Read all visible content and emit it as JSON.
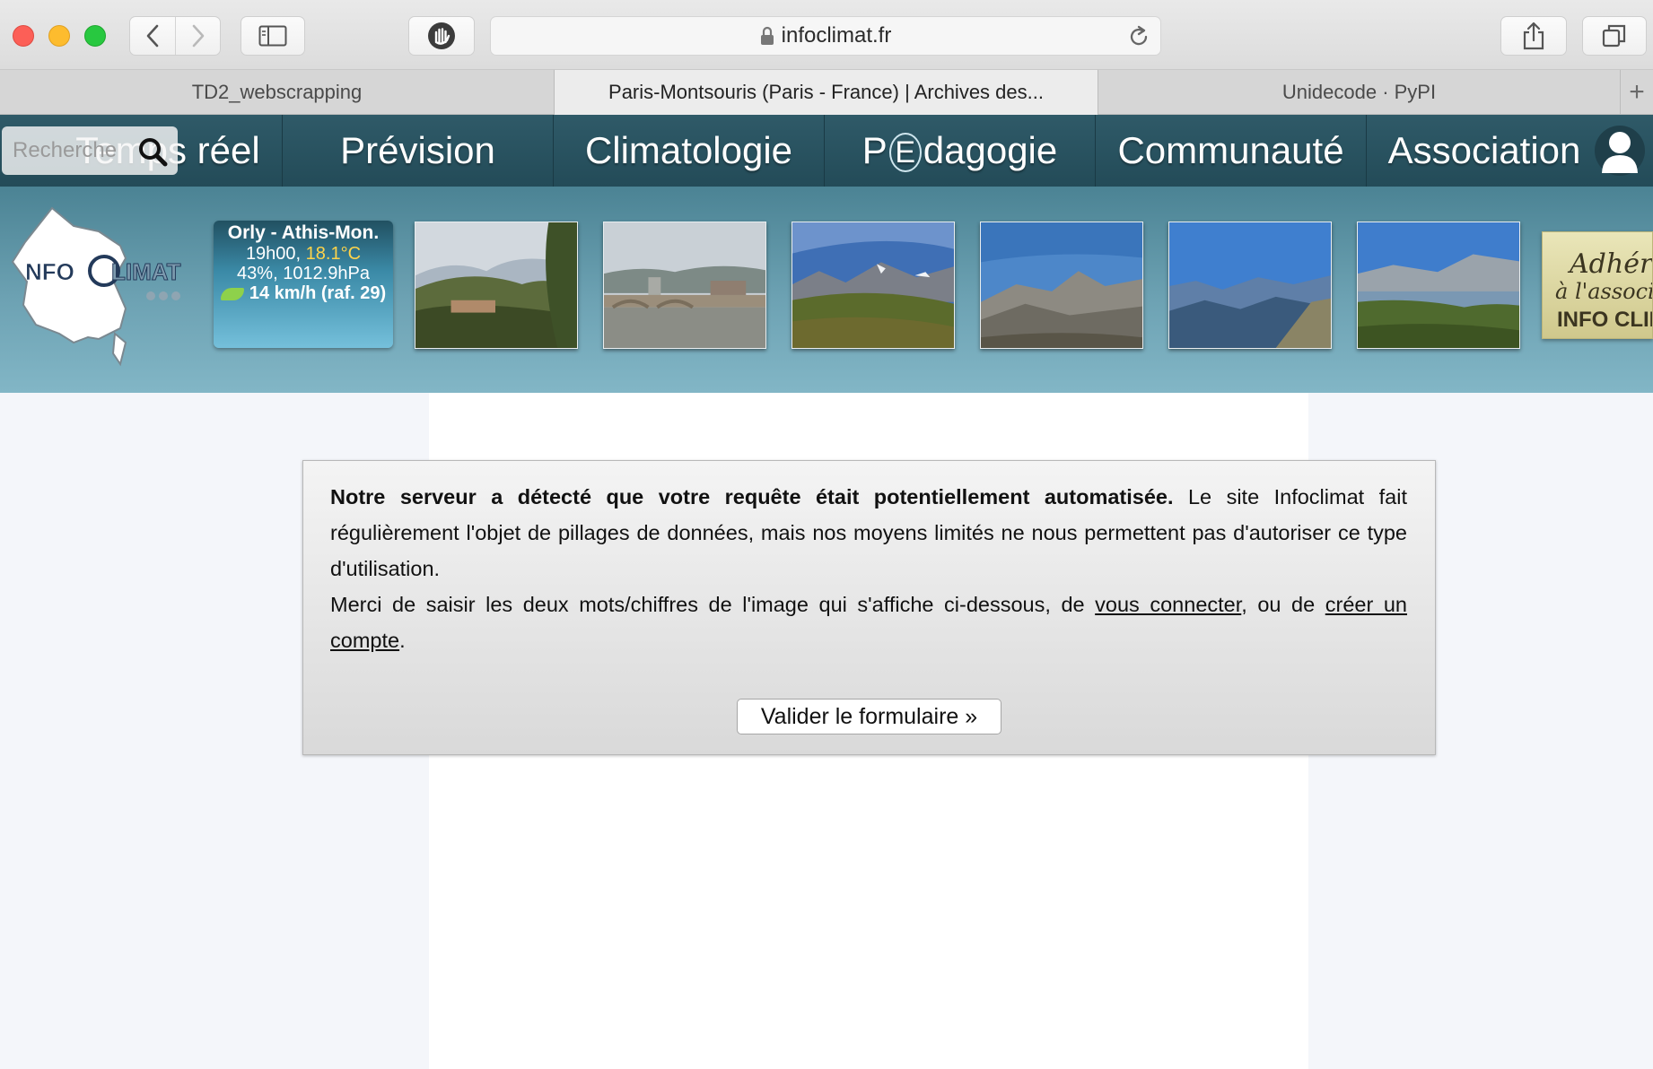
{
  "browser": {
    "url": "infoclimat.fr",
    "tabs": [
      {
        "label": "TD2_webscrapping",
        "active": false
      },
      {
        "label": "Paris-Montsouris (Paris - France) | Archives des...",
        "active": true
      },
      {
        "label": "Unidecode · PyPI",
        "active": false
      }
    ],
    "new_tab_symbol": "+",
    "icons": {
      "back": "chevron-left-icon",
      "forward": "chevron-right-icon",
      "sidebar": "sidebar-icon",
      "privacy": "hand-icon",
      "lock": "lock-icon",
      "reload": "reload-icon",
      "share": "share-icon",
      "tabs": "tabs-overview-icon"
    }
  },
  "site_nav": {
    "search_placeholder": "Recherche",
    "items": [
      {
        "label": "Temps réel"
      },
      {
        "label": "Prévision"
      },
      {
        "label": "Climatologie"
      },
      {
        "label_prefix": "P",
        "label_badge": "E",
        "label_suffix": "dagogie"
      },
      {
        "label": "Communauté"
      },
      {
        "label": "Association"
      }
    ],
    "colors": {
      "nav_bg": "#2a5362",
      "banner_bg": "#6da2b3"
    }
  },
  "banner": {
    "logo_text_left": "NFO",
    "logo_text_right": "LIMAT",
    "weather": {
      "station": "Orly - Athis-Mon.",
      "time": "19h00, ",
      "temperature": "18.1°C",
      "humidity_pressure": "43%, 1012.9hPa",
      "wind": "14 km/h (raf. 29)"
    },
    "photos": [
      "village-hills-photo",
      "city-river-bridge-photo",
      "alpine-meadow-photo",
      "mountain-range-photo",
      "blue-mountains-photo",
      "lake-mountains-photo"
    ],
    "adhere_lines": [
      "Adhérez",
      "à l'association",
      "INFO CLIMAT"
    ]
  },
  "notice": {
    "bold_lead": "Notre serveur a détecté que votre requête était potentiellement automatisée.",
    "text1": " Le site Infoclimat fait régulièrement l'objet de pillages de données, mais nos moyens limités ne nous permettent pas d'autoriser ce type d'utilisation.",
    "text2": "Merci de saisir les deux mots/chiffres de l'image qui s'affiche ci-dessous, de ",
    "link_login": "vous connecter",
    "text3": ", ou de ",
    "link_signup": "créer un compte",
    "text4": ".",
    "submit_label": "Valider le formulaire »"
  }
}
